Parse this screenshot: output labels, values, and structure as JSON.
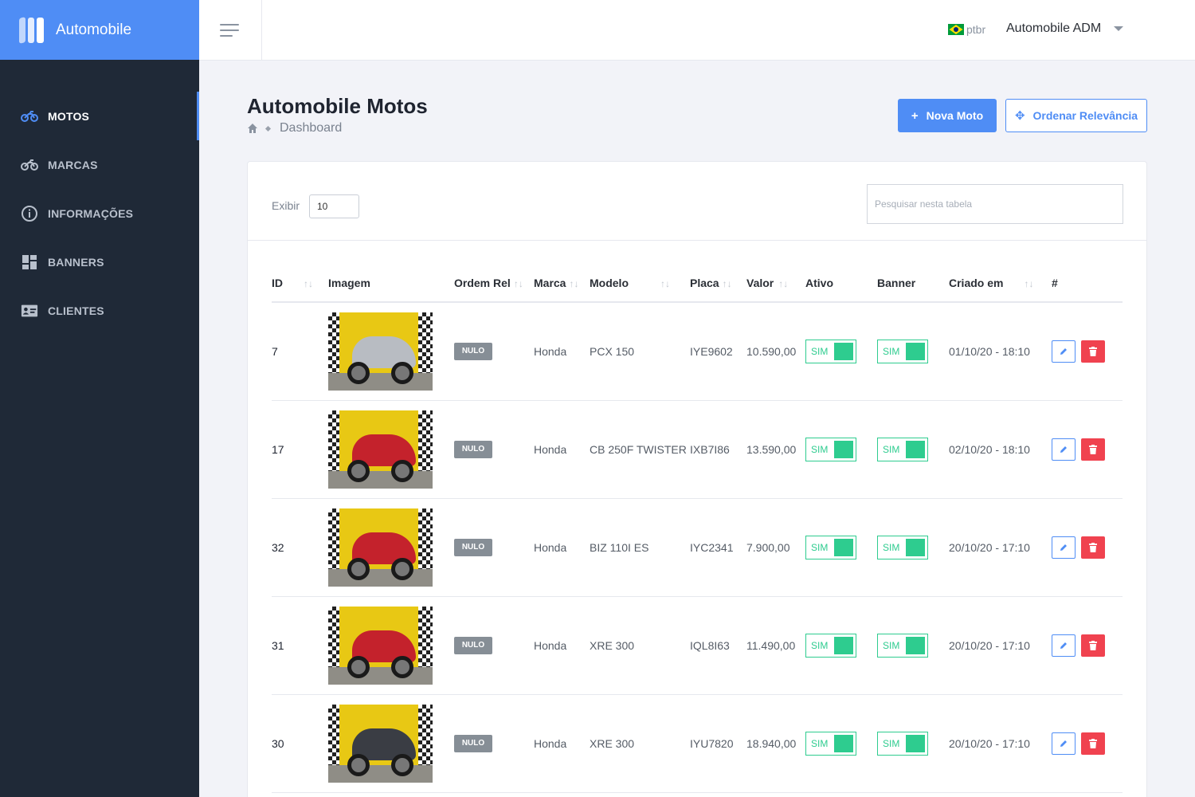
{
  "app": {
    "name": "Automobile"
  },
  "sidebar": {
    "items": [
      {
        "label": "MOTOS",
        "icon": "motorcycle-icon",
        "active": true
      },
      {
        "label": "MARCAS",
        "icon": "motorcycle-outline-icon",
        "active": false
      },
      {
        "label": "INFORMAÇÕES",
        "icon": "info-icon",
        "active": false
      },
      {
        "label": "BANNERS",
        "icon": "dashboard-grid-icon",
        "active": false
      },
      {
        "label": "CLIENTES",
        "icon": "id-card-icon",
        "active": false
      }
    ]
  },
  "topbar": {
    "language": "ptbr",
    "user": "Automobile ADM"
  },
  "page": {
    "title": "Automobile Motos",
    "breadcrumb": "Dashboard",
    "new_button": "Nova Moto",
    "order_button": "Ordenar Relevância"
  },
  "table": {
    "show_label": "Exibir",
    "show_value": "10",
    "search_placeholder": "Pesquisar nesta tabela",
    "headers": {
      "id": "ID",
      "image": "Imagem",
      "order": "Ordem Rel",
      "brand": "Marca",
      "model": "Modelo",
      "plate": "Placa",
      "value": "Valor",
      "active": "Ativo",
      "banner": "Banner",
      "created": "Criado em",
      "actions": "#"
    },
    "sort_glyph": "↑↓",
    "rows": [
      {
        "id": "7",
        "order": "NULO",
        "brand": "Honda",
        "model": "PCX 150",
        "plate": "IYE9602",
        "value": "10.590,00",
        "active": "SIM",
        "banner": "SIM",
        "created": "01/10/20 - 18:10",
        "bike_color": "#b8bcc2"
      },
      {
        "id": "17",
        "order": "NULO",
        "brand": "Honda",
        "model": "CB 250F TWISTER",
        "plate": "IXB7I86",
        "value": "13.590,00",
        "active": "SIM",
        "banner": "SIM",
        "created": "02/10/20 - 18:10",
        "bike_color": "#c4222c"
      },
      {
        "id": "32",
        "order": "NULO",
        "brand": "Honda",
        "model": "BIZ 110I ES",
        "plate": "IYC2341",
        "value": "7.900,00",
        "active": "SIM",
        "banner": "SIM",
        "created": "20/10/20 - 17:10",
        "bike_color": "#c4222c"
      },
      {
        "id": "31",
        "order": "NULO",
        "brand": "Honda",
        "model": "XRE 300",
        "plate": "IQL8I63",
        "value": "11.490,00",
        "active": "SIM",
        "banner": "SIM",
        "created": "20/10/20 - 17:10",
        "bike_color": "#c4222c"
      },
      {
        "id": "30",
        "order": "NULO",
        "brand": "Honda",
        "model": "XRE 300",
        "plate": "IYU7820",
        "value": "18.940,00",
        "active": "SIM",
        "banner": "SIM",
        "created": "20/10/20 - 17:10",
        "bike_color": "#3a3d44"
      }
    ]
  },
  "colors": {
    "accent": "#4f8df5",
    "sidebar": "#1f2937",
    "toggle_on": "#2ecc8f",
    "danger": "#f0424f",
    "badge": "#868e96"
  }
}
